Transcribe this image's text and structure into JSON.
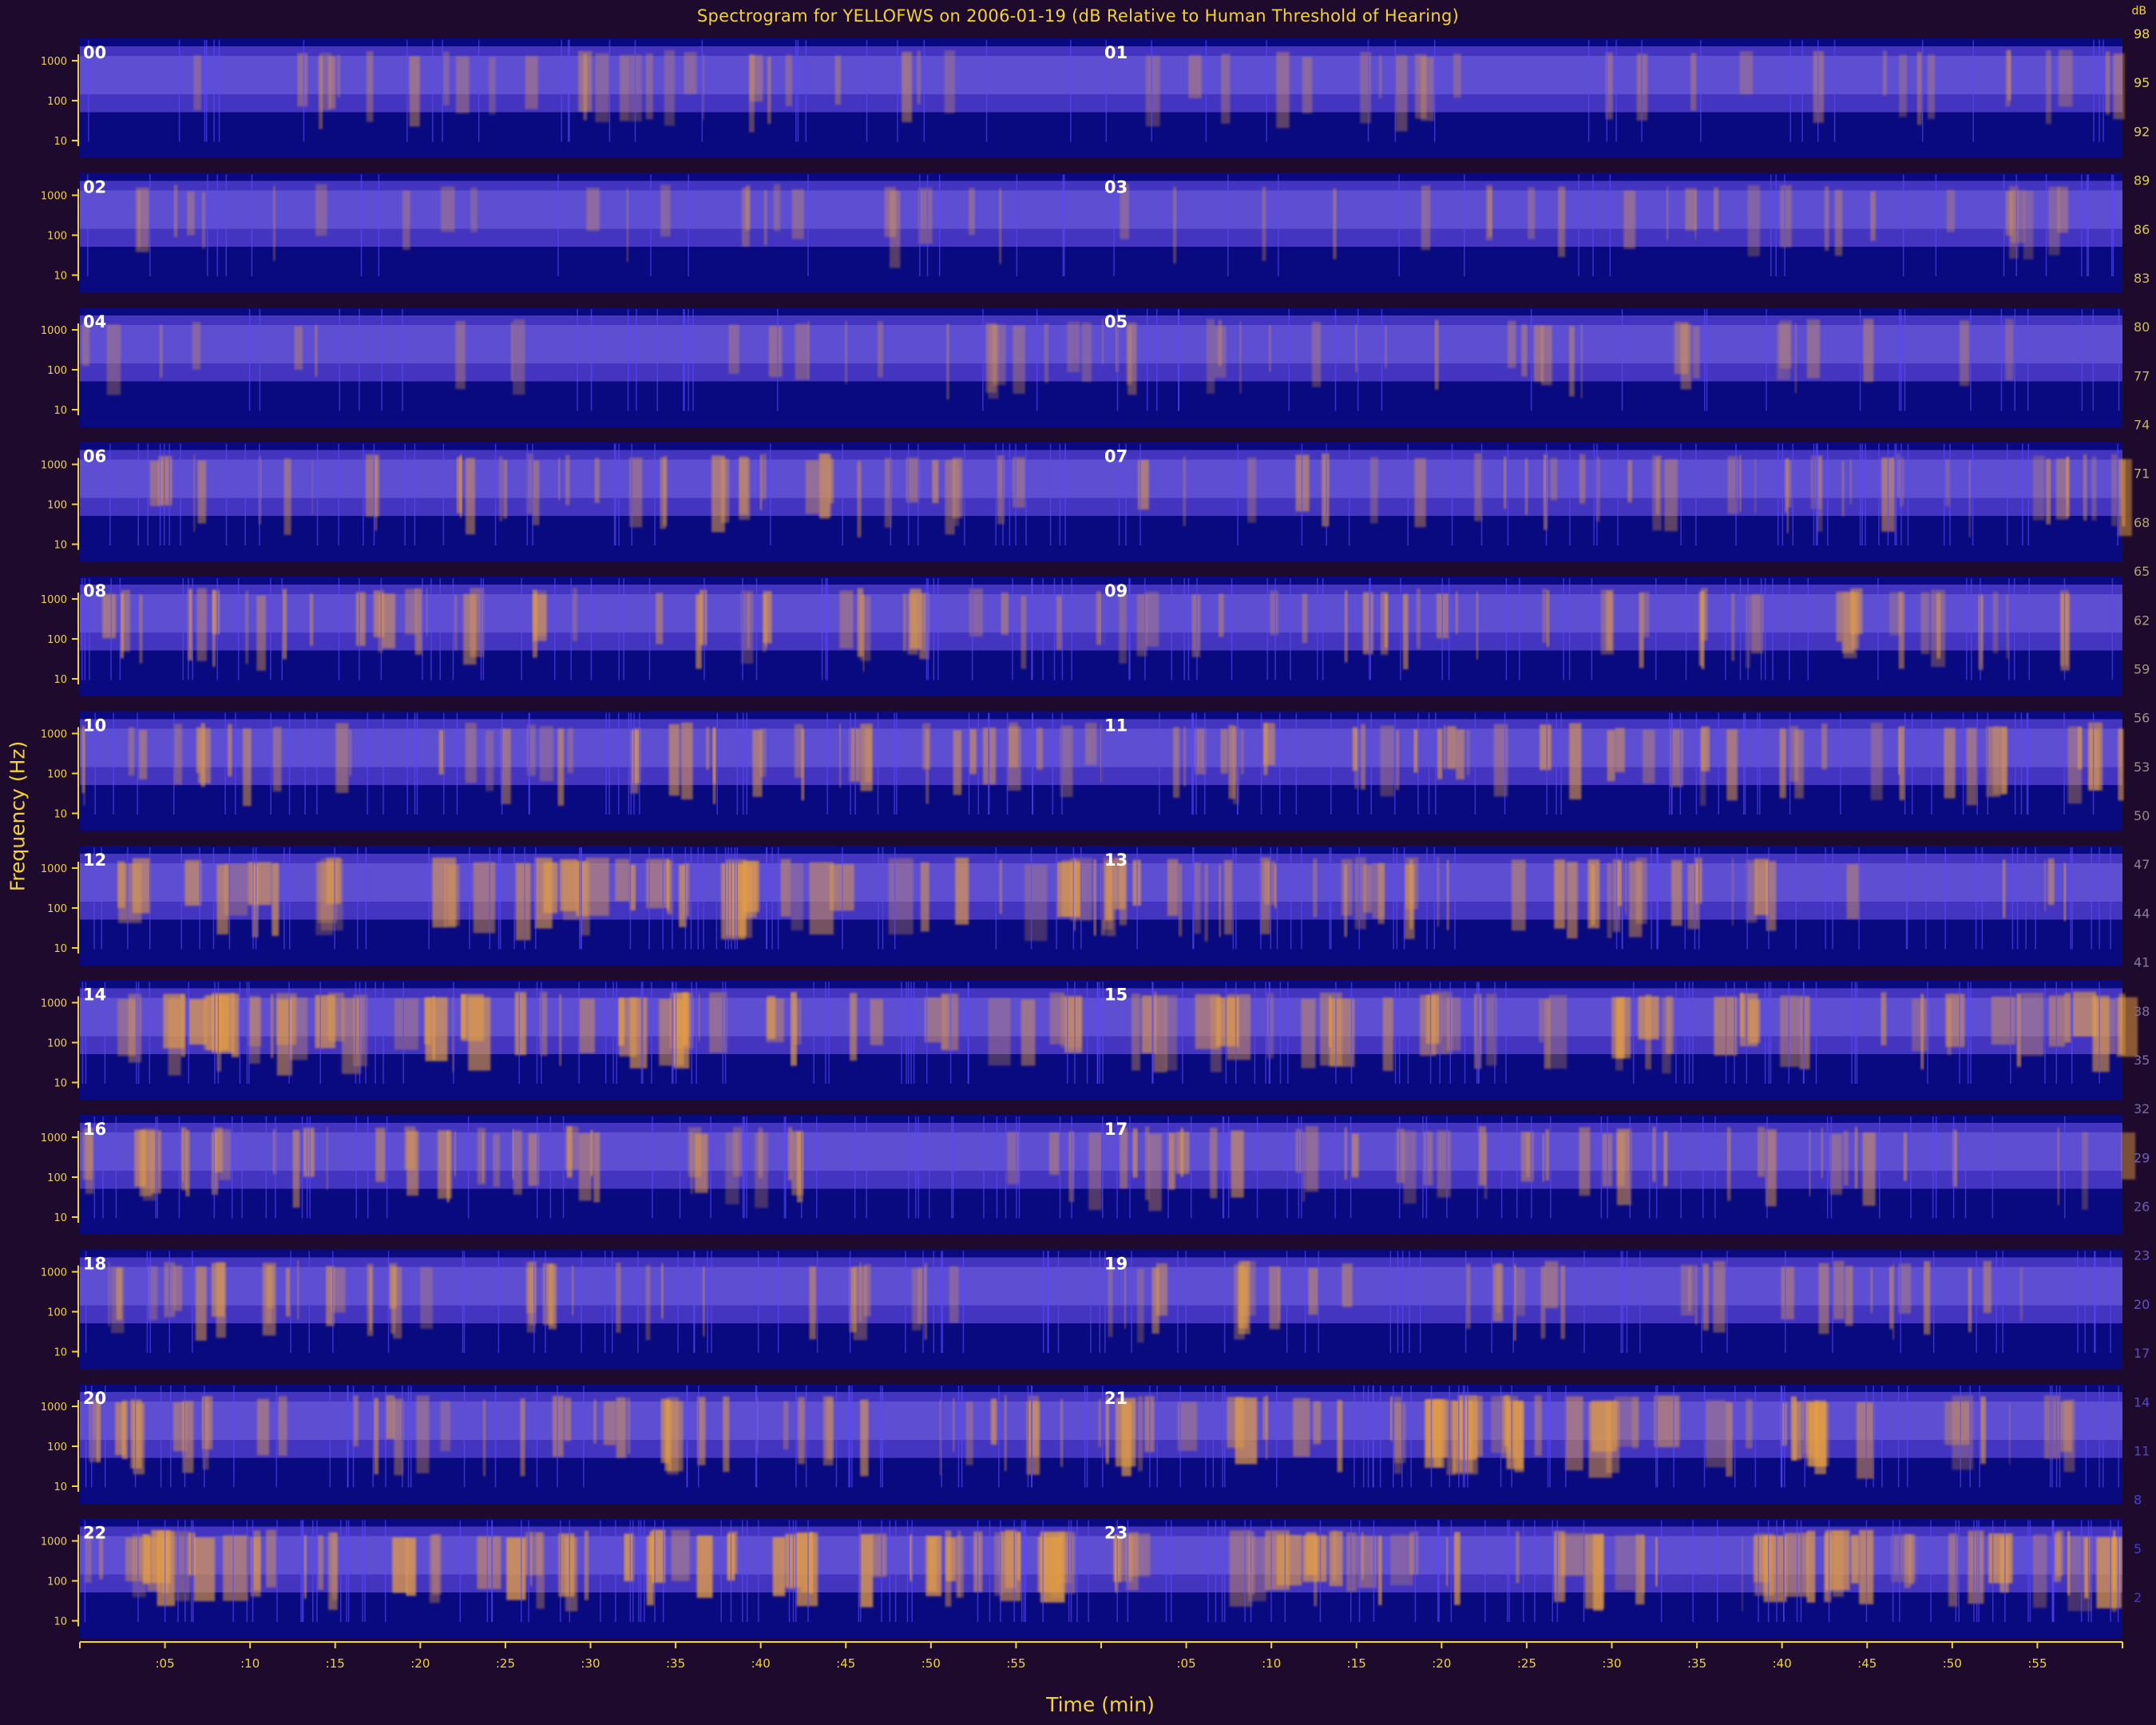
{
  "chart_data": {
    "type": "heatmap",
    "title": "Spectrogram for YELLOFWS on 2006-01-19 (dB Relative to Human Threshold of Hearing)",
    "xlabel": "Time (min)",
    "ylabel": "Frequency (Hz)",
    "rows": [
      "00",
      "01",
      "02",
      "03",
      "04",
      "05",
      "06",
      "07",
      "08",
      "09",
      "10",
      "11",
      "12",
      "13",
      "14",
      "15",
      "16",
      "17",
      "18",
      "19",
      "20",
      "21",
      "22",
      "23"
    ],
    "x_tick_labels": [
      ":05",
      ":10",
      ":15",
      ":20",
      ":25",
      ":30",
      ":35",
      ":40",
      ":45",
      ":50",
      ":55"
    ],
    "y_tick_labels": [
      "1000",
      "100",
      "10"
    ],
    "colorbar_label": "dB",
    "colorbar_ticks": [
      98,
      95,
      92,
      89,
      86,
      83,
      80,
      77,
      74,
      71,
      68,
      65,
      62,
      59,
      56,
      53,
      50,
      47,
      44,
      41,
      38,
      35,
      32,
      29,
      26,
      23,
      20,
      17,
      14,
      11,
      8,
      5,
      2
    ],
    "colorbar_range": [
      0,
      100
    ],
    "hour_activity": [
      0.35,
      0.3,
      0.25,
      0.3,
      0.25,
      0.35,
      0.55,
      0.6,
      0.65,
      0.6,
      0.65,
      0.65,
      0.75,
      0.7,
      0.8,
      0.75,
      0.65,
      0.6,
      0.55,
      0.5,
      0.65,
      0.8,
      0.95,
      0.85
    ],
    "colors": {
      "background": "#1e0a2c",
      "floor": "#0a0a80",
      "band": "#4a3ac8",
      "hot": "#e8a040",
      "axis": "#f2d23a",
      "row_label": "#ffffff"
    }
  }
}
